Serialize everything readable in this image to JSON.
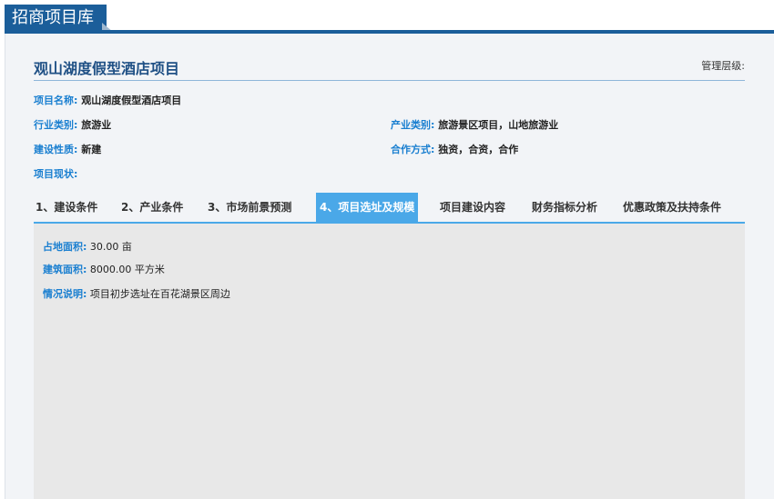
{
  "header": {
    "title": "招商项目库"
  },
  "project": {
    "title": "观山湖度假型酒店项目",
    "management_level_label": "管理层级:",
    "fields": {
      "name": {
        "label": "项目名称:",
        "value": "观山湖度假型酒店项目"
      },
      "industry_type": {
        "label": "行业类别:",
        "value": "旅游业"
      },
      "sector_type": {
        "label": "产业类别:",
        "value": "旅游景区项目，山地旅游业"
      },
      "construction_nature": {
        "label": "建设性质:",
        "value": "新建"
      },
      "cooperation": {
        "label": "合作方式:",
        "value": "独资，合资，合作"
      },
      "status": {
        "label": "项目现状:",
        "value": ""
      }
    }
  },
  "tabs": [
    {
      "label": "1、建设条件",
      "active": false
    },
    {
      "label": "2、产业条件",
      "active": false
    },
    {
      "label": "3、市场前景预测",
      "active": false
    },
    {
      "label": "4、项目选址及规模",
      "active": true
    },
    {
      "label": "项目建设内容",
      "active": false
    },
    {
      "label": "财务指标分析",
      "active": false
    },
    {
      "label": "优惠政策及扶持条件",
      "active": false
    }
  ],
  "site": {
    "land_area": {
      "label": "占地面积:",
      "value": "30.00 亩"
    },
    "building_area": {
      "label": "建筑面积:",
      "value": "8000.00 平方米"
    },
    "description": {
      "label": "情况说明:",
      "value": "项目初步选址在百花湖景区周边"
    }
  },
  "colors": {
    "brand": "#1b5e9a",
    "accent": "#4aa8e8",
    "label": "#1a7fd0"
  }
}
